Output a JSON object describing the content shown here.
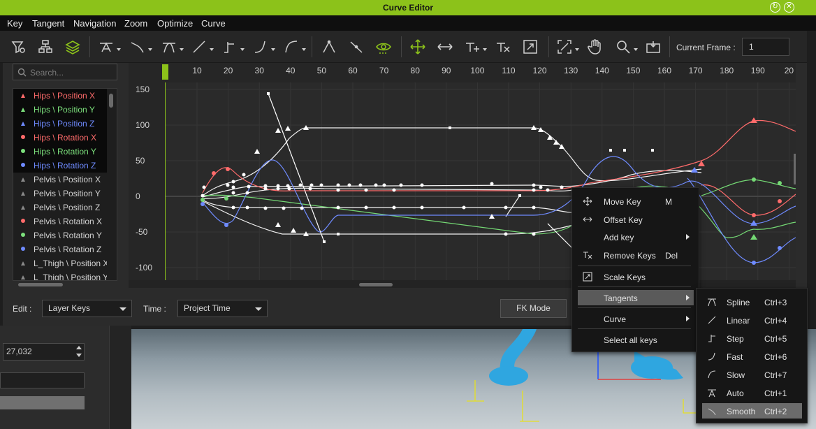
{
  "window": {
    "title": "Curve Editor"
  },
  "menubar": [
    "Key",
    "Tangent",
    "Navigation",
    "Zoom",
    "Optimize",
    "Curve"
  ],
  "toolbar": {
    "icons": [
      "filter-icon",
      "hierarchy-icon",
      "layers-icon",
      "tangent-auto-icon",
      "tangent-smooth-icon",
      "tangent-spline-icon",
      "tangent-linear-icon",
      "tangent-step-icon",
      "tangent-fast-icon",
      "tangent-slow-icon",
      "break-tangent-icon",
      "unify-tangent-icon",
      "view-selected-icon",
      "move-key-icon",
      "offset-key-icon",
      "add-key-icon",
      "remove-keys-icon",
      "scale-keys-icon",
      "fit-view-icon",
      "pan-hand-icon",
      "zoom-icon",
      "snapshot-icon"
    ],
    "current_frame_label": "Current Frame :",
    "current_frame_value": "1"
  },
  "search": {
    "placeholder": "Search..."
  },
  "tracks": [
    {
      "label": "Hips \\ Position X",
      "color": "#ff6b6b",
      "marker": "triangle",
      "selected": true
    },
    {
      "label": "Hips \\ Position Y",
      "color": "#7ce07c",
      "marker": "triangle",
      "selected": true
    },
    {
      "label": "Hips \\ Position Z",
      "color": "#6f8bff",
      "marker": "triangle",
      "selected": true
    },
    {
      "label": "Hips \\ Rotation X",
      "color": "#ff6b6b",
      "marker": "dot",
      "selected": true
    },
    {
      "label": "Hips \\ Rotation Y",
      "color": "#7ce07c",
      "marker": "dot",
      "selected": true
    },
    {
      "label": "Hips \\ Rotation Z",
      "color": "#6f8bff",
      "marker": "dot",
      "selected": true
    },
    {
      "label": "Pelvis \\ Position X",
      "color": "#8a8a8a",
      "marker": "triangle",
      "selected": false
    },
    {
      "label": "Pelvis \\ Position Y",
      "color": "#8a8a8a",
      "marker": "triangle",
      "selected": false
    },
    {
      "label": "Pelvis \\ Position Z",
      "color": "#8a8a8a",
      "marker": "triangle",
      "selected": false
    },
    {
      "label": "Pelvis \\ Rotation X",
      "color": "#ff6b6b",
      "marker": "dot",
      "selected": false
    },
    {
      "label": "Pelvis \\ Rotation Y",
      "color": "#7ce07c",
      "marker": "dot",
      "selected": false
    },
    {
      "label": "Pelvis \\ Rotation Z",
      "color": "#6f8bff",
      "marker": "dot",
      "selected": false
    },
    {
      "label": "L_Thigh \\ Position X",
      "color": "#8a8a8a",
      "marker": "triangle",
      "selected": false
    },
    {
      "label": "L_Thigh \\ Position Y",
      "color": "#8a8a8a",
      "marker": "triangle",
      "selected": false
    }
  ],
  "graph": {
    "frame_ticks": [
      "10",
      "20",
      "30",
      "40",
      "50",
      "60",
      "70",
      "80",
      "90",
      "100",
      "110",
      "120",
      "130",
      "140",
      "150",
      "160",
      "170",
      "180",
      "190",
      "20"
    ],
    "value_ticks": [
      "150",
      "100",
      "50",
      "0",
      "-50",
      "-100"
    ],
    "colors": {
      "red": "#ff6b6b",
      "green": "#74d874",
      "blue": "#6f8bff",
      "white": "#f2f2f2",
      "playhead": "#8cc21a"
    }
  },
  "bottombar": {
    "edit_label": "Edit :",
    "edit_value": "Layer Keys",
    "time_label": "Time :",
    "time_value": "Project Time",
    "fk_mode": "FK Mode"
  },
  "lower_left": {
    "spin_value": "27,032"
  },
  "context_menu": {
    "items": [
      {
        "label": "Move Key",
        "shortcut": "M",
        "icon": "move-icon"
      },
      {
        "label": "Offset Key",
        "shortcut": "",
        "icon": "offset-icon"
      },
      {
        "label": "Add key",
        "shortcut": "",
        "icon": "",
        "submenu": true
      },
      {
        "label": "Remove Keys",
        "shortcut": "Del",
        "icon": "remove-keys-icon"
      },
      {
        "label": "Scale Keys",
        "shortcut": "",
        "icon": "scale-keys-icon"
      },
      {
        "label": "Tangents",
        "shortcut": "",
        "icon": "",
        "submenu": true
      },
      {
        "label": "Curve",
        "shortcut": "",
        "icon": "",
        "submenu": true
      },
      {
        "label": "Select all keys",
        "shortcut": "",
        "icon": ""
      }
    ]
  },
  "tangents_submenu": {
    "items": [
      {
        "label": "Spline",
        "shortcut": "Ctrl+3",
        "icon": "spline-icon"
      },
      {
        "label": "Linear",
        "shortcut": "Ctrl+4",
        "icon": "linear-icon"
      },
      {
        "label": "Step",
        "shortcut": "Ctrl+5",
        "icon": "step-icon"
      },
      {
        "label": "Fast",
        "shortcut": "Ctrl+6",
        "icon": "fast-icon"
      },
      {
        "label": "Slow",
        "shortcut": "Ctrl+7",
        "icon": "slow-icon"
      },
      {
        "label": "Auto",
        "shortcut": "Ctrl+1",
        "icon": "auto-icon"
      },
      {
        "label": "Smooth",
        "shortcut": "Ctrl+2",
        "icon": "smooth-icon"
      }
    ]
  }
}
